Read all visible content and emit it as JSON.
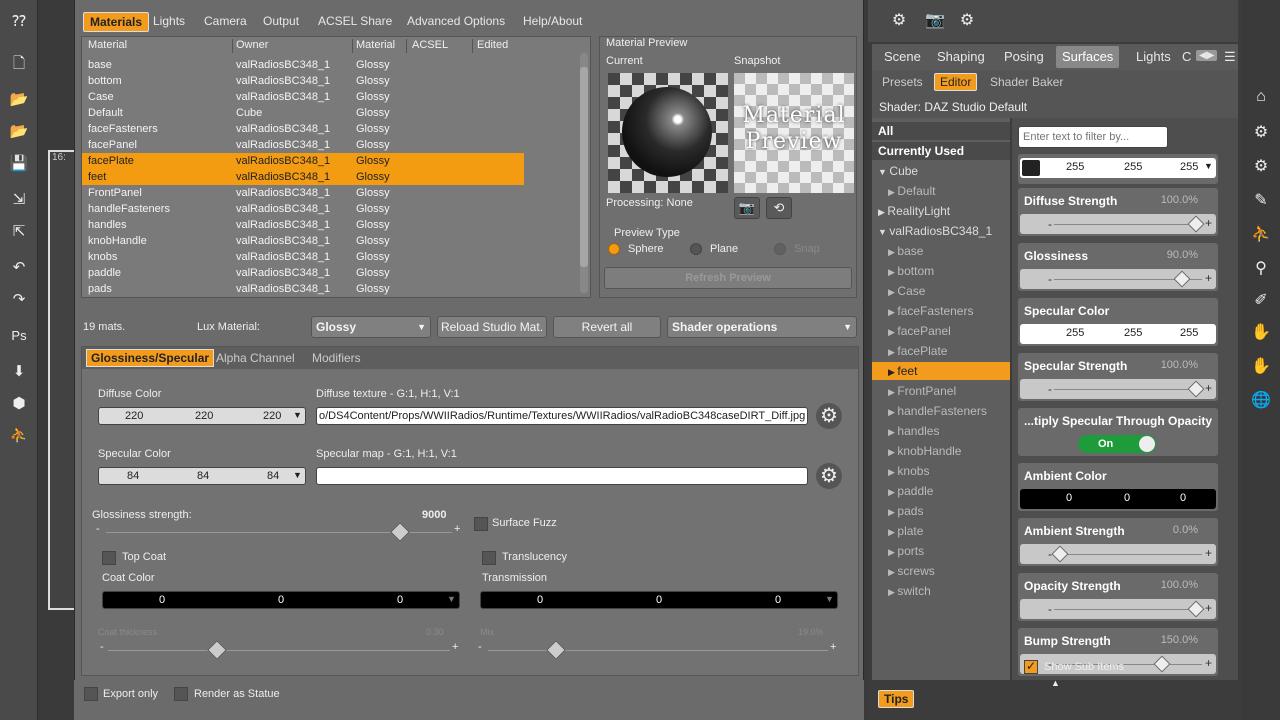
{
  "dialog": {
    "menu": [
      "Materials",
      "Lights",
      "Camera",
      "Output",
      "ACSEL Share",
      "Advanced Options",
      "Help/About"
    ],
    "table": {
      "headers": [
        "Material",
        "Owner",
        "Material",
        "ACSEL",
        "Edited"
      ],
      "rows": [
        {
          "material": "base",
          "owner": "valRadiosBC348_1",
          "type": "Glossy"
        },
        {
          "material": "bottom",
          "owner": "valRadiosBC348_1",
          "type": "Glossy"
        },
        {
          "material": "Case",
          "owner": "valRadiosBC348_1",
          "type": "Glossy"
        },
        {
          "material": "Default",
          "owner": "Cube",
          "type": "Glossy"
        },
        {
          "material": "faceFasteners",
          "owner": "valRadiosBC348_1",
          "type": "Glossy"
        },
        {
          "material": "facePanel",
          "owner": "valRadiosBC348_1",
          "type": "Glossy"
        },
        {
          "material": "facePlate",
          "owner": "valRadiosBC348_1",
          "type": "Glossy"
        },
        {
          "material": "feet",
          "owner": "valRadiosBC348_1",
          "type": "Glossy"
        },
        {
          "material": "FrontPanel",
          "owner": "valRadiosBC348_1",
          "type": "Glossy"
        },
        {
          "material": "handleFasteners",
          "owner": "valRadiosBC348_1",
          "type": "Glossy"
        },
        {
          "material": "handles",
          "owner": "valRadiosBC348_1",
          "type": "Glossy"
        },
        {
          "material": "knobHandle",
          "owner": "valRadiosBC348_1",
          "type": "Glossy"
        },
        {
          "material": "knobs",
          "owner": "valRadiosBC348_1",
          "type": "Glossy"
        },
        {
          "material": "paddle",
          "owner": "valRadiosBC348_1",
          "type": "Glossy"
        },
        {
          "material": "pads",
          "owner": "valRadiosBC348_1",
          "type": "Glossy"
        }
      ]
    },
    "preview": {
      "title": "Material Preview",
      "current": "Current",
      "snapshot": "Snapshot",
      "snapshot_text": "Material Preview",
      "processing": "Processing: None",
      "preview_type": "Preview Type",
      "sphere": "Sphere",
      "plane": "Plane",
      "snap": "Snap",
      "refresh": "Refresh Preview"
    },
    "mats_count": "19 mats.",
    "lux_material_label": "Lux Material:",
    "lux_material_value": "Glossy",
    "reload": "Reload Studio Mat.",
    "revert": "Revert all",
    "shader_ops": "Shader operations",
    "tabs": [
      "Glossiness/Specular",
      "Alpha Channel",
      "Modifiers"
    ],
    "diffuse_color": {
      "label": "Diffuse Color",
      "r": "220",
      "g": "220",
      "b": "220"
    },
    "diffuse_texture": {
      "label": "Diffuse texture - G:1, H:1, V:1",
      "value": "o/DS4Content/Props/WWIIRadios/Runtime/Textures/WWIIRadios/valRadioBC348caseDIRT_Diff.jpg"
    },
    "specular_color": {
      "label": "Specular Color",
      "r": "84",
      "g": "84",
      "b": "84"
    },
    "specular_map": {
      "label": "Specular map - G:1, H:1, V:1",
      "value": ""
    },
    "glossiness": {
      "label": "Glossiness strength:",
      "value": "9000",
      "level": 0.85
    },
    "surface_fuzz": "Surface Fuzz",
    "top_coat": "Top Coat",
    "coat_color": {
      "label": "Coat Color",
      "r": "0",
      "g": "0",
      "b": "0"
    },
    "coat_thickness": {
      "label": "Coat thickness",
      "value": "0.30",
      "level": 0.32
    },
    "translucency": "Translucency",
    "transmission": {
      "label": "Transmission",
      "r": "0",
      "g": "0",
      "b": "0"
    },
    "mix": {
      "label": "Mix",
      "value": "19.0%",
      "level": 0.2
    },
    "export_only": "Export only",
    "render_statue": "Render as Statue"
  },
  "viewport": {
    "tag": "16:"
  },
  "right": {
    "tabs": [
      "Scene",
      "Shaping",
      "Posing",
      "Surfaces",
      "Lights",
      "C"
    ],
    "subtabs": [
      "Presets",
      "Editor",
      "Shader Baker"
    ],
    "shader": "Shader: DAZ Studio Default",
    "filter_placeholder": "Enter text to filter by...",
    "tree": [
      {
        "label": "All",
        "kind": "bold"
      },
      {
        "label": "Currently Used",
        "kind": "bold"
      },
      {
        "label": "Cube",
        "kind": "group",
        "arrow": "▼"
      },
      {
        "label": "Default",
        "kind": "child"
      },
      {
        "label": "RealityLight",
        "kind": "group",
        "arrow": "▶"
      },
      {
        "label": "valRadiosBC348_1",
        "kind": "group",
        "arrow": "▼"
      },
      {
        "label": "base",
        "kind": "child"
      },
      {
        "label": "bottom",
        "kind": "child"
      },
      {
        "label": "Case",
        "kind": "child"
      },
      {
        "label": "faceFasteners",
        "kind": "child"
      },
      {
        "label": "facePanel",
        "kind": "child"
      },
      {
        "label": "facePlate",
        "kind": "child"
      },
      {
        "label": "feet",
        "kind": "sel"
      },
      {
        "label": "FrontPanel",
        "kind": "child"
      },
      {
        "label": "handleFasteners",
        "kind": "child"
      },
      {
        "label": "handles",
        "kind": "child"
      },
      {
        "label": "knobHandle",
        "kind": "child"
      },
      {
        "label": "knobs",
        "kind": "child"
      },
      {
        "label": "paddle",
        "kind": "child"
      },
      {
        "label": "pads",
        "kind": "child"
      },
      {
        "label": "plate",
        "kind": "child"
      },
      {
        "label": "ports",
        "kind": "child"
      },
      {
        "label": "screws",
        "kind": "child"
      },
      {
        "label": "switch",
        "kind": "child"
      }
    ],
    "top_color": {
      "r": "255",
      "g": "255",
      "b": "255"
    },
    "props": [
      {
        "title": "Diffuse Strength",
        "value": "100.0%",
        "type": "slider",
        "level": 1.0
      },
      {
        "title": "Glossiness",
        "value": "90.0%",
        "type": "slider",
        "level": 0.9
      },
      {
        "title": "Specular Color",
        "value": "",
        "type": "color",
        "r": "255",
        "g": "255",
        "b": "255"
      },
      {
        "title": "Specular Strength",
        "value": "100.0%",
        "type": "slider",
        "level": 1.0
      },
      {
        "title": "...tiply Specular Through Opacity",
        "value": "",
        "type": "toggle",
        "toggle": "On"
      },
      {
        "title": "Ambient Color",
        "value": "",
        "type": "color-dark",
        "r": "0",
        "g": "0",
        "b": "0"
      },
      {
        "title": "Ambient Strength",
        "value": "0.0%",
        "type": "slider",
        "level": 0.0
      },
      {
        "title": "Opacity Strength",
        "value": "100.0%",
        "type": "slider",
        "level": 1.0
      },
      {
        "title": "Bump Strength",
        "value": "150.0%",
        "type": "slider",
        "level": 0.75
      }
    ],
    "show_sub_items": "Show Sub Items",
    "tips": "Tips"
  }
}
